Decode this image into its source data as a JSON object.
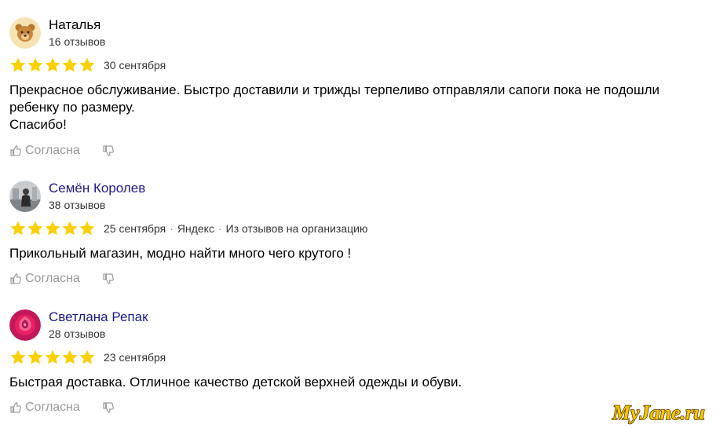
{
  "reviews": [
    {
      "author": "Наталья",
      "review_count": "16 отзывов",
      "rating": 5,
      "date": "30 сентября",
      "source": "",
      "source_note": "",
      "text_lines": [
        "Прекрасное обслуживание. Быстро доставили и трижды терпеливо отправляли сапоги пока не подошли",
        "ребенку по размеру.",
        "Спасибо!"
      ],
      "agree_label": "Согласна",
      "avatar_icon": "bear-avatar-icon",
      "name_color": "#000000"
    },
    {
      "author": "Семён Королев",
      "review_count": "38 отзывов",
      "rating": 5,
      "date": "25 сентября",
      "source": "Яндекс",
      "source_note": "Из отзывов на организацию",
      "text_lines": [
        "Прикольный магазин, модно найти много чего крутого !"
      ],
      "agree_label": "Согласна",
      "avatar_icon": "photo-avatar-icon",
      "name_color": "#1a1a8c"
    },
    {
      "author": "Светлана Репак",
      "review_count": "28 отзывов",
      "rating": 5,
      "date": "23 сентября",
      "source": "",
      "source_note": "",
      "text_lines": [
        "Быстрая доставка. Отличное качество детской верхней одежды и обуви."
      ],
      "agree_label": "Согласна",
      "avatar_icon": "rose-avatar-icon",
      "name_color": "#1a1a8c"
    }
  ],
  "watermark": "MyJane.ru",
  "colors": {
    "star": "#fcd000",
    "muted": "#999999",
    "link": "#1a1a8c"
  }
}
